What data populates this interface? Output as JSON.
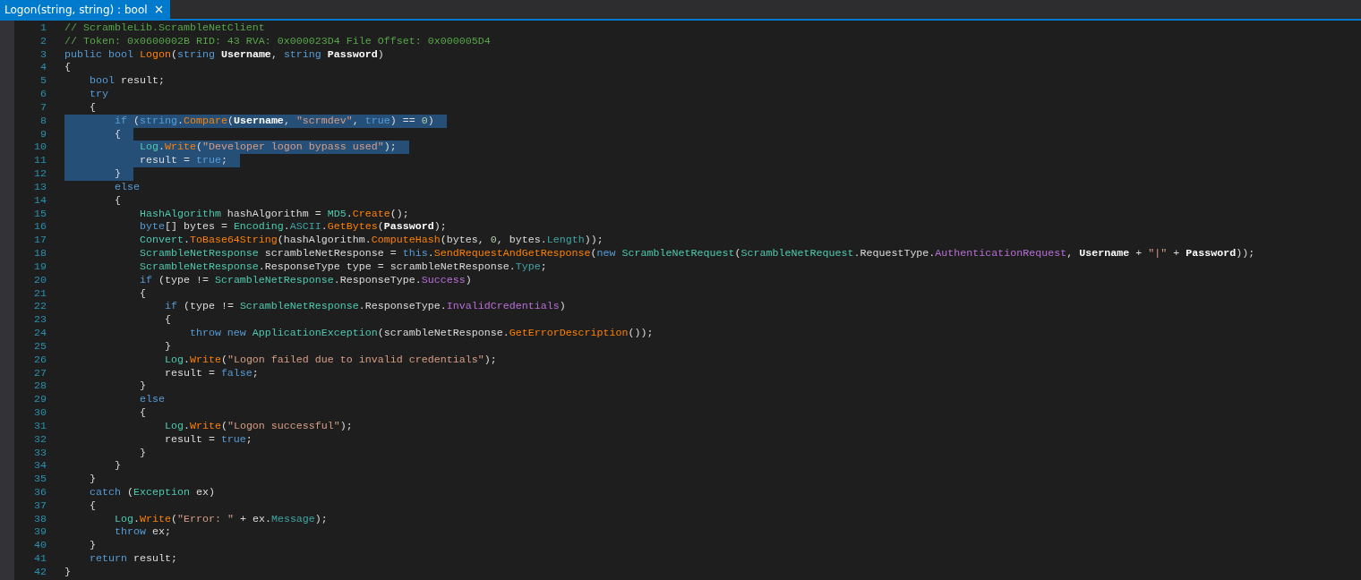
{
  "tab": {
    "title": "Logon(string, string) : bool",
    "selected": true
  },
  "lines": [
    {
      "number": "1",
      "selected": false,
      "tokens": [
        {
          "kind": "comment",
          "text": "// ScrambleLib.ScrambleNetClient"
        }
      ]
    },
    {
      "number": "2",
      "selected": false,
      "tokens": [
        {
          "kind": "comment",
          "text": "// Token: 0x0600002B RID: 43 RVA: 0x000023D4 File Offset: 0x000005D4"
        }
      ]
    },
    {
      "number": "3",
      "selected": false,
      "tokens": [
        {
          "kind": "keyword",
          "text": "public bool "
        },
        {
          "kind": "method",
          "text": "Logon"
        },
        {
          "kind": "plain",
          "text": "("
        },
        {
          "kind": "keyword",
          "text": "string "
        },
        {
          "kind": "param",
          "text": "Username"
        },
        {
          "kind": "plain",
          "text": ", "
        },
        {
          "kind": "keyword",
          "text": "string "
        },
        {
          "kind": "param",
          "text": "Password"
        },
        {
          "kind": "plain",
          "text": ")"
        }
      ]
    },
    {
      "number": "4",
      "selected": false,
      "tokens": [
        {
          "kind": "plain",
          "text": "{"
        }
      ]
    },
    {
      "number": "5",
      "selected": false,
      "tokens": [
        {
          "kind": "keyword",
          "text": "    bool"
        },
        {
          "kind": "plain",
          "text": " result;"
        }
      ]
    },
    {
      "number": "6",
      "selected": false,
      "tokens": [
        {
          "kind": "keyword",
          "text": "    try"
        }
      ]
    },
    {
      "number": "7",
      "selected": false,
      "tokens": [
        {
          "kind": "plain",
          "text": "    {"
        }
      ]
    },
    {
      "number": "8",
      "selected": true,
      "tokens": [
        {
          "kind": "keyword",
          "text": "        if"
        },
        {
          "kind": "plain",
          "text": " ("
        },
        {
          "kind": "keyword",
          "text": "string"
        },
        {
          "kind": "plain",
          "text": "."
        },
        {
          "kind": "method",
          "text": "Compare"
        },
        {
          "kind": "plain",
          "text": "("
        },
        {
          "kind": "param",
          "text": "Username"
        },
        {
          "kind": "plain",
          "text": ", "
        },
        {
          "kind": "string",
          "text": "\"scrmdev\""
        },
        {
          "kind": "plain",
          "text": ", "
        },
        {
          "kind": "keyword",
          "text": "true"
        },
        {
          "kind": "plain",
          "text": ") == "
        },
        {
          "kind": "number",
          "text": "0"
        },
        {
          "kind": "plain",
          "text": ")"
        }
      ]
    },
    {
      "number": "9",
      "selected": true,
      "tokens": [
        {
          "kind": "plain",
          "text": "        {"
        }
      ]
    },
    {
      "number": "10",
      "selected": true,
      "tokens": [
        {
          "kind": "type",
          "text": "            Log"
        },
        {
          "kind": "plain",
          "text": "."
        },
        {
          "kind": "method",
          "text": "Write"
        },
        {
          "kind": "plain",
          "text": "("
        },
        {
          "kind": "string",
          "text": "\"Developer logon bypass used\""
        },
        {
          "kind": "plain",
          "text": ");"
        }
      ]
    },
    {
      "number": "11",
      "selected": true,
      "tokens": [
        {
          "kind": "plain",
          "text": "            result = "
        },
        {
          "kind": "keyword",
          "text": "true"
        },
        {
          "kind": "plain",
          "text": ";"
        }
      ]
    },
    {
      "number": "12",
      "selected": true,
      "tokens": [
        {
          "kind": "plain",
          "text": "        }"
        }
      ]
    },
    {
      "number": "13",
      "selected": false,
      "tokens": [
        {
          "kind": "keyword",
          "text": "        else"
        }
      ]
    },
    {
      "number": "14",
      "selected": false,
      "tokens": [
        {
          "kind": "plain",
          "text": "        {"
        }
      ]
    },
    {
      "number": "15",
      "selected": false,
      "tokens": [
        {
          "kind": "type",
          "text": "            HashAlgorithm"
        },
        {
          "kind": "plain",
          "text": " hashAlgorithm = "
        },
        {
          "kind": "type",
          "text": "MD5"
        },
        {
          "kind": "plain",
          "text": "."
        },
        {
          "kind": "method",
          "text": "Create"
        },
        {
          "kind": "plain",
          "text": "();"
        }
      ]
    },
    {
      "number": "16",
      "selected": false,
      "tokens": [
        {
          "kind": "keyword",
          "text": "            byte"
        },
        {
          "kind": "plain",
          "text": "[] bytes = "
        },
        {
          "kind": "type",
          "text": "Encoding"
        },
        {
          "kind": "plain",
          "text": "."
        },
        {
          "kind": "property",
          "text": "ASCII"
        },
        {
          "kind": "plain",
          "text": "."
        },
        {
          "kind": "method",
          "text": "GetBytes"
        },
        {
          "kind": "plain",
          "text": "("
        },
        {
          "kind": "param",
          "text": "Password"
        },
        {
          "kind": "plain",
          "text": ");"
        }
      ]
    },
    {
      "number": "17",
      "selected": false,
      "tokens": [
        {
          "kind": "type",
          "text": "            Convert"
        },
        {
          "kind": "plain",
          "text": "."
        },
        {
          "kind": "method",
          "text": "ToBase64String"
        },
        {
          "kind": "plain",
          "text": "(hashAlgorithm."
        },
        {
          "kind": "method",
          "text": "ComputeHash"
        },
        {
          "kind": "plain",
          "text": "(bytes, "
        },
        {
          "kind": "number",
          "text": "0"
        },
        {
          "kind": "plain",
          "text": ", bytes."
        },
        {
          "kind": "property",
          "text": "Length"
        },
        {
          "kind": "plain",
          "text": "));"
        }
      ]
    },
    {
      "number": "18",
      "selected": false,
      "tokens": [
        {
          "kind": "type",
          "text": "            ScrambleNetResponse"
        },
        {
          "kind": "plain",
          "text": " scrambleNetResponse = "
        },
        {
          "kind": "keyword",
          "text": "this"
        },
        {
          "kind": "plain",
          "text": "."
        },
        {
          "kind": "method",
          "text": "SendRequestAndGetResponse"
        },
        {
          "kind": "plain",
          "text": "("
        },
        {
          "kind": "keyword",
          "text": "new "
        },
        {
          "kind": "type",
          "text": "ScrambleNetRequest"
        },
        {
          "kind": "plain",
          "text": "("
        },
        {
          "kind": "type",
          "text": "ScrambleNetRequest"
        },
        {
          "kind": "plain",
          "text": ".RequestType."
        },
        {
          "kind": "enum",
          "text": "AuthenticationRequest"
        },
        {
          "kind": "plain",
          "text": ", "
        },
        {
          "kind": "param",
          "text": "Username"
        },
        {
          "kind": "plain",
          "text": " + "
        },
        {
          "kind": "string",
          "text": "\"|\""
        },
        {
          "kind": "plain",
          "text": " + "
        },
        {
          "kind": "param",
          "text": "Password"
        },
        {
          "kind": "plain",
          "text": "));"
        }
      ]
    },
    {
      "number": "19",
      "selected": false,
      "tokens": [
        {
          "kind": "type",
          "text": "            ScrambleNetResponse"
        },
        {
          "kind": "plain",
          "text": ".ResponseType type = scrambleNetResponse."
        },
        {
          "kind": "property",
          "text": "Type"
        },
        {
          "kind": "plain",
          "text": ";"
        }
      ]
    },
    {
      "number": "20",
      "selected": false,
      "tokens": [
        {
          "kind": "keyword",
          "text": "            if"
        },
        {
          "kind": "plain",
          "text": " (type != "
        },
        {
          "kind": "type",
          "text": "ScrambleNetResponse"
        },
        {
          "kind": "plain",
          "text": ".ResponseType."
        },
        {
          "kind": "enum",
          "text": "Success"
        },
        {
          "kind": "plain",
          "text": ")"
        }
      ]
    },
    {
      "number": "21",
      "selected": false,
      "tokens": [
        {
          "kind": "plain",
          "text": "            {"
        }
      ]
    },
    {
      "number": "22",
      "selected": false,
      "tokens": [
        {
          "kind": "keyword",
          "text": "                if"
        },
        {
          "kind": "plain",
          "text": " (type != "
        },
        {
          "kind": "type",
          "text": "ScrambleNetResponse"
        },
        {
          "kind": "plain",
          "text": ".ResponseType."
        },
        {
          "kind": "enum",
          "text": "InvalidCredentials"
        },
        {
          "kind": "plain",
          "text": ")"
        }
      ]
    },
    {
      "number": "23",
      "selected": false,
      "tokens": [
        {
          "kind": "plain",
          "text": "                {"
        }
      ]
    },
    {
      "number": "24",
      "selected": false,
      "tokens": [
        {
          "kind": "keyword",
          "text": "                    throw new "
        },
        {
          "kind": "type",
          "text": "ApplicationException"
        },
        {
          "kind": "plain",
          "text": "(scrambleNetResponse."
        },
        {
          "kind": "method",
          "text": "GetErrorDescription"
        },
        {
          "kind": "plain",
          "text": "());"
        }
      ]
    },
    {
      "number": "25",
      "selected": false,
      "tokens": [
        {
          "kind": "plain",
          "text": "                }"
        }
      ]
    },
    {
      "number": "26",
      "selected": false,
      "tokens": [
        {
          "kind": "type",
          "text": "                Log"
        },
        {
          "kind": "plain",
          "text": "."
        },
        {
          "kind": "method",
          "text": "Write"
        },
        {
          "kind": "plain",
          "text": "("
        },
        {
          "kind": "string",
          "text": "\"Logon failed due to invalid credentials\""
        },
        {
          "kind": "plain",
          "text": ");"
        }
      ]
    },
    {
      "number": "27",
      "selected": false,
      "tokens": [
        {
          "kind": "plain",
          "text": "                result = "
        },
        {
          "kind": "keyword",
          "text": "false"
        },
        {
          "kind": "plain",
          "text": ";"
        }
      ]
    },
    {
      "number": "28",
      "selected": false,
      "tokens": [
        {
          "kind": "plain",
          "text": "            }"
        }
      ]
    },
    {
      "number": "29",
      "selected": false,
      "tokens": [
        {
          "kind": "keyword",
          "text": "            else"
        }
      ]
    },
    {
      "number": "30",
      "selected": false,
      "tokens": [
        {
          "kind": "plain",
          "text": "            {"
        }
      ]
    },
    {
      "number": "31",
      "selected": false,
      "tokens": [
        {
          "kind": "type",
          "text": "                Log"
        },
        {
          "kind": "plain",
          "text": "."
        },
        {
          "kind": "method",
          "text": "Write"
        },
        {
          "kind": "plain",
          "text": "("
        },
        {
          "kind": "string",
          "text": "\"Logon successful\""
        },
        {
          "kind": "plain",
          "text": ");"
        }
      ]
    },
    {
      "number": "32",
      "selected": false,
      "tokens": [
        {
          "kind": "plain",
          "text": "                result = "
        },
        {
          "kind": "keyword",
          "text": "true"
        },
        {
          "kind": "plain",
          "text": ";"
        }
      ]
    },
    {
      "number": "33",
      "selected": false,
      "tokens": [
        {
          "kind": "plain",
          "text": "            }"
        }
      ]
    },
    {
      "number": "34",
      "selected": false,
      "tokens": [
        {
          "kind": "plain",
          "text": "        }"
        }
      ]
    },
    {
      "number": "35",
      "selected": false,
      "tokens": [
        {
          "kind": "plain",
          "text": "    }"
        }
      ]
    },
    {
      "number": "36",
      "selected": false,
      "tokens": [
        {
          "kind": "keyword",
          "text": "    catch"
        },
        {
          "kind": "plain",
          "text": " ("
        },
        {
          "kind": "type",
          "text": "Exception"
        },
        {
          "kind": "plain",
          "text": " ex)"
        }
      ]
    },
    {
      "number": "37",
      "selected": false,
      "tokens": [
        {
          "kind": "plain",
          "text": "    {"
        }
      ]
    },
    {
      "number": "38",
      "selected": false,
      "tokens": [
        {
          "kind": "type",
          "text": "        Log"
        },
        {
          "kind": "plain",
          "text": "."
        },
        {
          "kind": "method",
          "text": "Write"
        },
        {
          "kind": "plain",
          "text": "("
        },
        {
          "kind": "string",
          "text": "\"Error: \""
        },
        {
          "kind": "plain",
          "text": " + ex."
        },
        {
          "kind": "property",
          "text": "Message"
        },
        {
          "kind": "plain",
          "text": ");"
        }
      ]
    },
    {
      "number": "39",
      "selected": false,
      "tokens": [
        {
          "kind": "keyword",
          "text": "        throw"
        },
        {
          "kind": "plain",
          "text": " ex;"
        }
      ]
    },
    {
      "number": "40",
      "selected": false,
      "tokens": [
        {
          "kind": "plain",
          "text": "    }"
        }
      ]
    },
    {
      "number": "41",
      "selected": false,
      "tokens": [
        {
          "kind": "keyword",
          "text": "    return"
        },
        {
          "kind": "plain",
          "text": " result;"
        }
      ]
    },
    {
      "number": "42",
      "selected": false,
      "tokens": [
        {
          "kind": "plain",
          "text": "}"
        }
      ]
    }
  ]
}
